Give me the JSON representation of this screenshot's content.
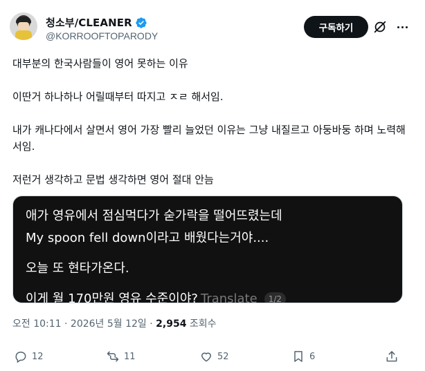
{
  "header": {
    "display_name": "청소부/CLEANER",
    "handle": "@KORROOFTOPARODY",
    "follow_label": "구독하기"
  },
  "tweet": {
    "paragraphs": [
      "대부분의 한국사람들이 영어 못하는 이유",
      "이딴거 하나하나 어릴때부터 따지고 ㅈㄹ 해서임.",
      "내가 캐나다에서 살면서 영어 가장 빨리 늘었던 이유는 그냥 내질르고 아둥바둥 하며 노력해서임.",
      "저런거 생각하고 문법 생각하면 영어 절대 안늠"
    ]
  },
  "media": {
    "line1": "애가 영유에서 점심먹다가 숟가락을 떨어뜨렸는데",
    "line2": "My spoon fell down이라고 배웠다는거야....",
    "line3": "오늘 또 현타가온다.",
    "line4": "이게 월 170만원 영유 수준이야?",
    "translate_label": "Translate",
    "pager": "1/2"
  },
  "meta": {
    "time": "오전 10:11 · 2026년 5월 12일 · ",
    "views_count": "2,954",
    "views_label": " 조회수"
  },
  "actions": {
    "reply_count": "12",
    "retweet_count": "11",
    "like_count": "52",
    "bookmark_count": "6"
  },
  "colors": {
    "text": "#0f1419",
    "secondary": "#536471",
    "verified": "#1d9bf0",
    "media_bg": "#111111"
  }
}
